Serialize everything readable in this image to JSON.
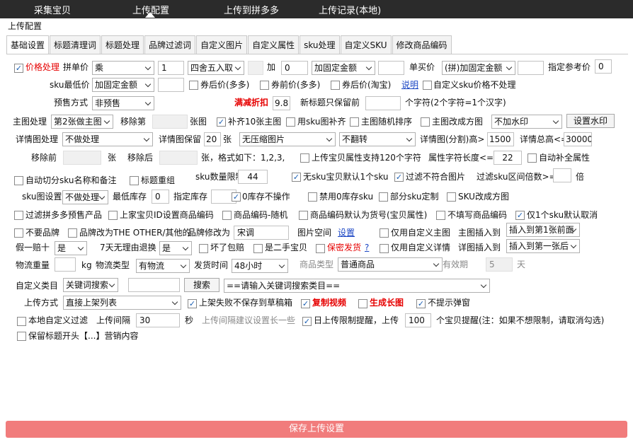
{
  "nav": [
    "采集宝贝",
    "上传配置",
    "上传到拼多多",
    "上传记录(本地)"
  ],
  "section_title": "上传配置",
  "tabs": [
    "基础设置",
    "标题清理词",
    "标题处理",
    "品牌过滤词",
    "自定义图片",
    "自定义属性",
    "sku处理",
    "自定义SKU",
    "修改商品编码"
  ],
  "r1": {
    "price": "价格处理",
    "pin": "拼单价",
    "op": "乘",
    "mult": "1",
    "round": "四舍五入取",
    "add": "加",
    "addval": "0",
    "fixed": "加固定金额",
    "single": "单买价",
    "single_sel": "(拼)加固定金额",
    "ref": "指定参考价",
    "refval": "0"
  },
  "r2": {
    "skumin": "sku最低价",
    "skusel": "加固定金额",
    "after_many": "券后价(多多)",
    "before_many": "券前价(多多)",
    "after_tb": "券后价(淘宝)",
    "explain": "说明",
    "custom_sku": "自定义sku价格不处理"
  },
  "r3": {
    "presale": "预售方式",
    "presale_sel": "非预售",
    "discount": "满减折扣",
    "discount_val": "9.8",
    "title_keep": "新标题只保留前",
    "title_unit": "个字符(2个字符=1个汉字)"
  },
  "r4": {
    "main": "主图处理",
    "main_sel": "第2张做主图",
    "remove": "移除第",
    "pic": "张图",
    "fill10": "补齐10张主图",
    "sku_fill": "用sku图补齐",
    "random": "主图随机排序",
    "square": "主图改成方图",
    "wm_sel": "不加水印",
    "wm_btn": "设置水印"
  },
  "r5": {
    "detail": "详情图处理",
    "detail_sel": "不做处理",
    "keep": "详情图保留",
    "keep_val": "20",
    "zhang": "张",
    "compress": "无压缩图片",
    "flip": "不翻转",
    "split": "详情图(分割)高>",
    "split_val": "1500",
    "total": "详情总高<=",
    "total_val": "30000"
  },
  "r6": {
    "before": "移除前",
    "zhang": "张",
    "after": "移除后",
    "fmt": "张，格式如下：1,2,3,",
    "attr120": "上传宝贝属性支持120个字符",
    "len": "属性字符长度<=",
    "len_val": "22",
    "auto_attr": "自动补全属性"
  },
  "r7": {
    "auto_split": "自动切分sku名称和备注",
    "title_group": "标题重组",
    "sku_limit": "sku数量限制",
    "sku_limit_val": "44",
    "nosku": "无sku宝贝默认1个sku",
    "filter_pic": "过滤不符合图片",
    "interval": "过滤sku区间倍数>=",
    "bei": "倍"
  },
  "r8": {
    "skuimg": "sku图设置",
    "skuimg_sel": "不做处理",
    "minstock": "最低库存",
    "minstock_val": "0",
    "stock": "指定库存",
    "zero": "0库存不操作",
    "forbid0": "禁用0库存sku",
    "partial": "部分sku定制",
    "skusquare": "SKU改成方图"
  },
  "r9": {
    "filter_pre": "过滤拼多多预售产品",
    "id_code": "上家宝贝ID设置商品编码",
    "code_rand": "商品编码-随机",
    "code_default": "商品编码默认为货号(宝贝属性)",
    "no_code": "不填写商品编码",
    "one_sku": "仅1个sku默认取消"
  },
  "r10": {
    "no_brand": "不要品牌",
    "brand_other": "品牌改为THE OTHER/其他的",
    "brand_to": "品牌修改为",
    "brand_val": "宋调",
    "space": "图片空间",
    "set": "设置",
    "custom_main": "仅用自定义主图",
    "main_insert": "主图插入到",
    "main_insert_sel": "插入到第1张前面"
  },
  "r11": {
    "fake": "假一赔十",
    "fake_sel": "是",
    "seven": "7天无理由退换",
    "seven_sel": "是",
    "broken": "坏了包赔",
    "second": "是二手宝贝",
    "secret": "保密发货",
    "q": "?",
    "custom_detail": "仅用自定义详情",
    "detail_insert": "详图插入到",
    "detail_insert_sel": "插入到第一张后"
  },
  "r12": {
    "weight": "物流重量",
    "kg": "kg",
    "ltype": "物流类型",
    "ltype_sel": "有物流",
    "ship": "发货时间",
    "ship_sel": "48小时",
    "ptype": "商品类型",
    "ptype_sel": "普通商品",
    "valid": "有效期",
    "valid_val": "5",
    "day": "天"
  },
  "r13": {
    "cat": "自定义类目",
    "cat_sel": "关键词搜索",
    "search": "搜索",
    "cat_list": "==请输入关键词搜索类目=="
  },
  "r14": {
    "mode": "上传方式",
    "mode_sel": "直接上架列表",
    "fail_draft": "上架失败不保存到草稿箱",
    "copy_video": "复制视频",
    "long_img": "生成长图",
    "no_popup": "不提示弹窗"
  },
  "r15": {
    "local_filter": "本地自定义过滤",
    "interval": "上传间隔",
    "interval_val": "30",
    "sec": "秒",
    "suggest": "上传间隔建议设置长一些",
    "daily": "日上传限制提醒，上传",
    "daily_val": "100",
    "daily_tip": "个宝贝提醒(注：如果不想限制，请取消勾选)"
  },
  "r16": {
    "keep_title": "保留标题开头【...】营销内容"
  },
  "save": "保存上传设置",
  "colors": {
    "accent_red": "#e60000",
    "save_bar": "#f17c7c",
    "top_bar": "#2b2b2b"
  }
}
